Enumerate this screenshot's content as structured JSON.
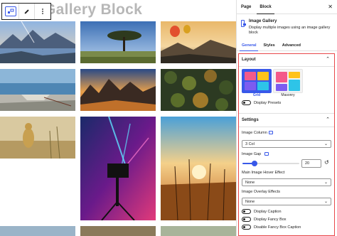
{
  "canvas": {
    "block_title": "Gallery Block",
    "toolbar": {
      "block_icon": "gallery-icon",
      "edit_icon": "pencil-icon",
      "more_icon": "vertical-ellipsis-icon"
    },
    "images": [
      {
        "subject": "lake-mountains-sunrise"
      },
      {
        "subject": "acacia-tree-savanna"
      },
      {
        "subject": "hot-air-balloons-mountains"
      },
      {
        "subject": "boat-on-beach"
      },
      {
        "subject": "desert-mountains-sunset"
      },
      {
        "subject": "aerial-forest-canopy"
      },
      {
        "subject": "cheetah-in-grass"
      },
      {
        "subject": "film-camera-stage-lights"
      },
      {
        "subject": "grass-field-sunset"
      }
    ]
  },
  "sidebar": {
    "tabs": [
      {
        "label": "Page"
      },
      {
        "label": "Block"
      }
    ],
    "active_tab": "Block",
    "close_icon": "close-icon",
    "block": {
      "name": "Image Gallery",
      "description": "Display multiple images using an image gallery block"
    },
    "sub_tabs": [
      {
        "label": "General"
      },
      {
        "label": "Styles"
      },
      {
        "label": "Advanced"
      }
    ],
    "active_sub_tab": "General",
    "layout": {
      "title": "Layout",
      "options": [
        {
          "label": "Grid",
          "selected": true
        },
        {
          "label": "Masonry",
          "selected": false
        }
      ],
      "display_presets": {
        "label": "Display Presets",
        "on": false
      }
    },
    "settings": {
      "title": "Settings",
      "image_column": {
        "label": "Image Column",
        "value": "3 Col"
      },
      "image_gap": {
        "label": "Image Gap",
        "value": "20"
      },
      "hover_effect": {
        "label": "Main Image Hover Effect",
        "value": "None"
      },
      "overlay_effects": {
        "label": "Image Overlay Effects",
        "value": "None"
      },
      "toggles": [
        {
          "label": "Display Caption",
          "on": false
        },
        {
          "label": "Display Fancy Box",
          "on": false
        },
        {
          "label": "Disable Fancy Box Caption",
          "on": false
        }
      ]
    },
    "colors": {
      "accent": "#3858e9",
      "highlight_border": "#e8474a"
    }
  }
}
